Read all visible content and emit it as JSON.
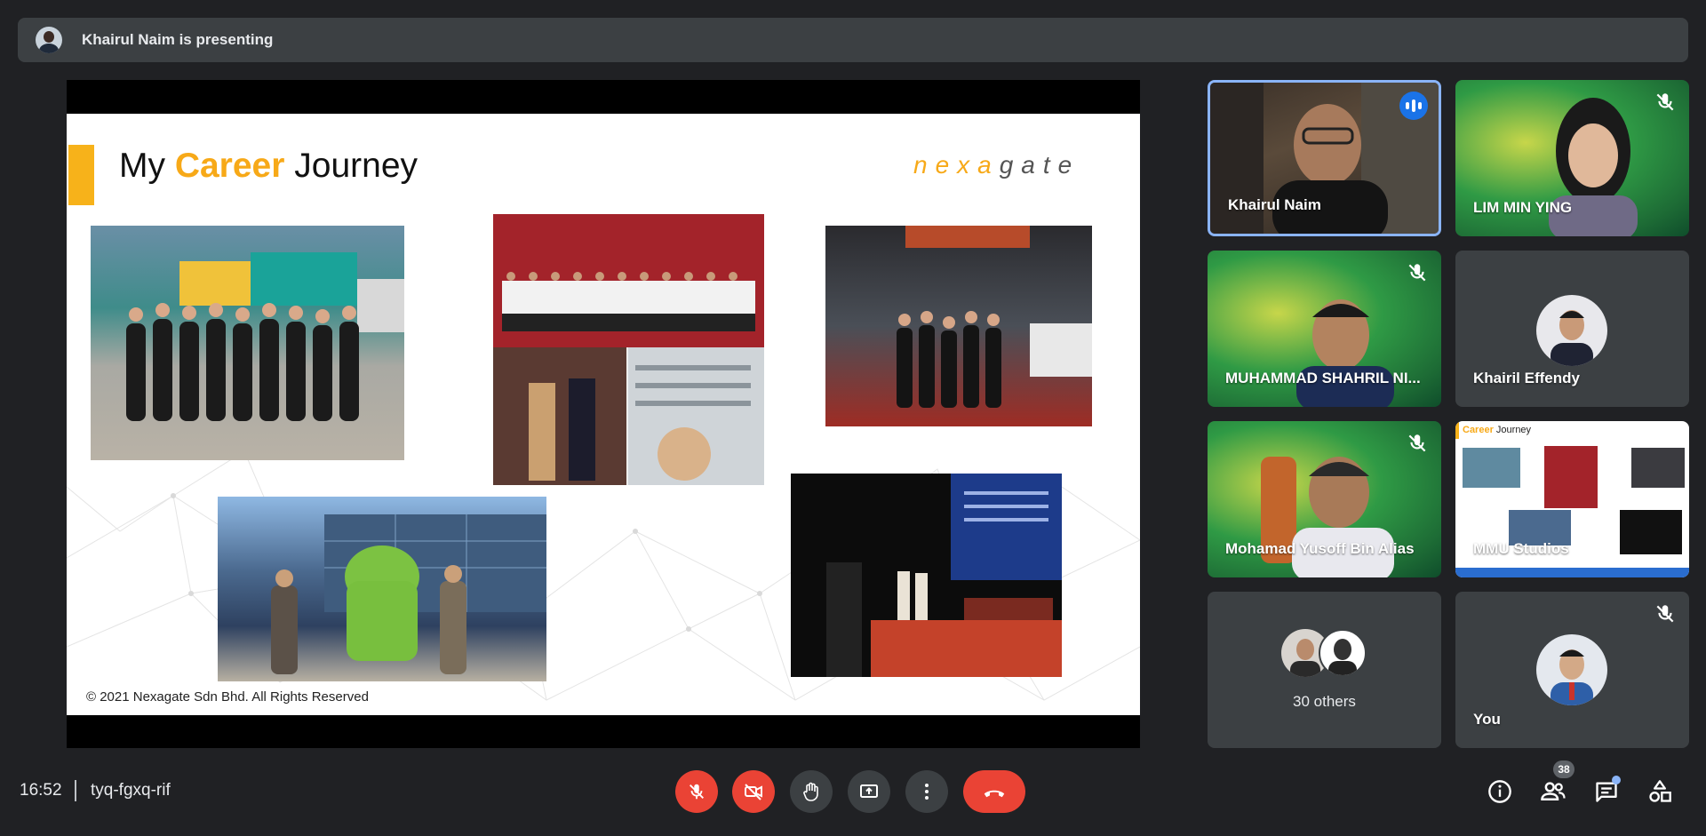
{
  "banner": {
    "presenting_text": "Khairul Naim is presenting"
  },
  "slide": {
    "title_prefix": "My ",
    "title_highlight": "Career",
    "title_suffix": " Journey",
    "logo_part1": "nexa",
    "logo_part2": "gate",
    "copyright": "© 2021 Nexagate Sdn Bhd. All Rights Reserved"
  },
  "participants": [
    {
      "name": "Khairul Naim",
      "status": "speaking"
    },
    {
      "name": "LIM MIN YING",
      "status": "muted"
    },
    {
      "name": "MUHAMMAD SHAHRIL NI...",
      "status": "muted"
    },
    {
      "name": "Khairil Effendy",
      "status": ""
    },
    {
      "name": "Mohamad Yusoff Bin Alias",
      "status": "muted"
    },
    {
      "name": "MMU Studios",
      "status": ""
    },
    {
      "name": "30 others",
      "status": ""
    },
    {
      "name": "You",
      "status": "muted"
    }
  ],
  "mmu_tile": {
    "slide_word": "Career",
    "slide_suffix": " Journey"
  },
  "meeting": {
    "time": "16:52",
    "code": "tyq-fgxq-rif",
    "participant_count": "38"
  },
  "colors": {
    "accent_orange": "#f7b21a",
    "end_call_red": "#ea4335",
    "speaking_blue": "#1a73e8",
    "active_border": "#8ab4f8"
  },
  "icons": {
    "mic": "mic-off-icon",
    "camera": "camera-off-icon",
    "hand": "raise-hand-icon",
    "present": "present-screen-icon",
    "more": "more-options-icon",
    "end": "end-call-icon",
    "info": "info-icon",
    "people": "people-icon",
    "chat": "chat-icon",
    "activities": "activities-icon"
  }
}
